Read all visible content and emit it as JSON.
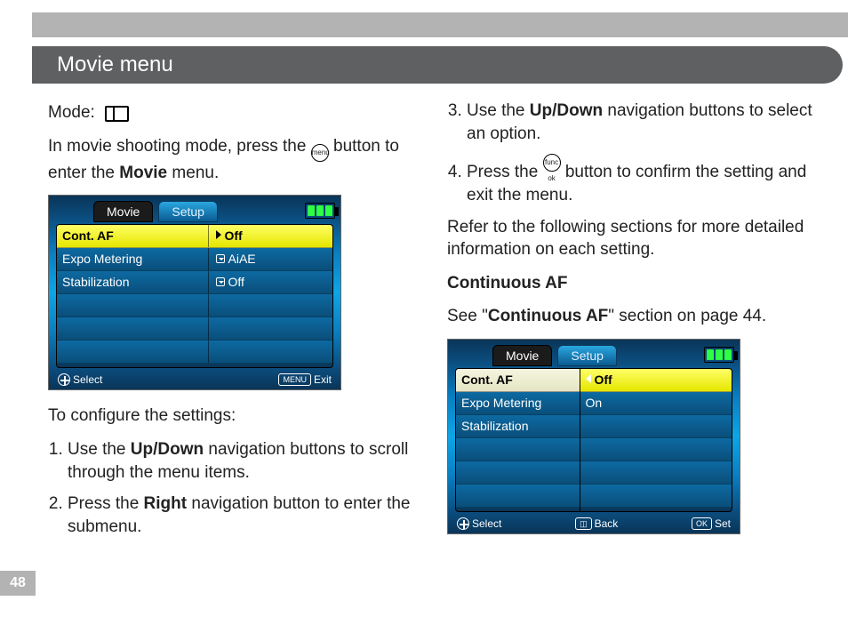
{
  "page_number": "48",
  "section_title": "Movie menu",
  "left": {
    "mode_label": "Mode:",
    "intro_a": "In movie shooting mode, press the ",
    "intro_b": " button to enter the ",
    "intro_bold": "Movie",
    "intro_c": " menu.",
    "configure_label": "To configure the settings:",
    "step1_a": "Use the ",
    "step1_bold": "Up/Down",
    "step1_b": " navigation buttons to scroll through the menu items.",
    "step2_a": "Press the ",
    "step2_bold": "Right",
    "step2_b": " navigation button to enter the submenu.",
    "menu_btn_text": "menu"
  },
  "screenshot1": {
    "tab_movie": "Movie",
    "tab_setup": "Setup",
    "rows": [
      {
        "label": "Cont. AF",
        "value": "Off",
        "selected": true,
        "indicator": "arrow"
      },
      {
        "label": "Expo Metering",
        "value": "AiAE",
        "selected": false,
        "indicator": "scroll"
      },
      {
        "label": "Stabilization",
        "value": "Off",
        "selected": false,
        "indicator": "scroll"
      }
    ],
    "foot_select": "Select",
    "foot_exit_btn": "MENU",
    "foot_exit": "Exit"
  },
  "right": {
    "step3_a": "Use the ",
    "step3_bold": "Up/Down",
    "step3_b": " navigation buttons to select an option.",
    "step4_a": "Press the ",
    "step4_b": " button to confirm the setting and exit the menu.",
    "func_btn_text": "func ok",
    "refer": "Refer to the following sections for more detailed information on each setting.",
    "subhead": "Continuous AF",
    "see_a": "See \"",
    "see_bold": "Continuous AF",
    "see_b": "\" section on page 44."
  },
  "screenshot2": {
    "tab_movie": "Movie",
    "tab_setup": "Setup",
    "left_rows": [
      "Cont. AF",
      "Expo Metering",
      "Stabilization"
    ],
    "right_rows": [
      "Off",
      "On"
    ],
    "foot_select": "Select",
    "foot_back": "Back",
    "foot_set_btn": "OK",
    "foot_set": "Set"
  }
}
